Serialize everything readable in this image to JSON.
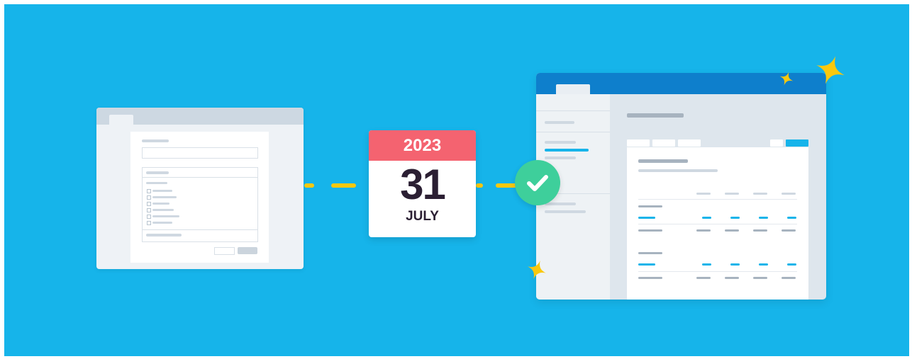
{
  "calendar": {
    "year": "2023",
    "day": "31",
    "month": "JULY"
  },
  "colors": {
    "background": "#16b4ea",
    "calendar_header": "#f46370",
    "calendar_text": "#2b1f33",
    "check_badge": "#3ecf9b",
    "connector": "#f9c80e",
    "dashboard_titlebar": "#0e7fcc",
    "sparkle": "#f9c80e"
  },
  "icons": {
    "check": "check-icon",
    "sparkle": "sparkle-icon"
  }
}
